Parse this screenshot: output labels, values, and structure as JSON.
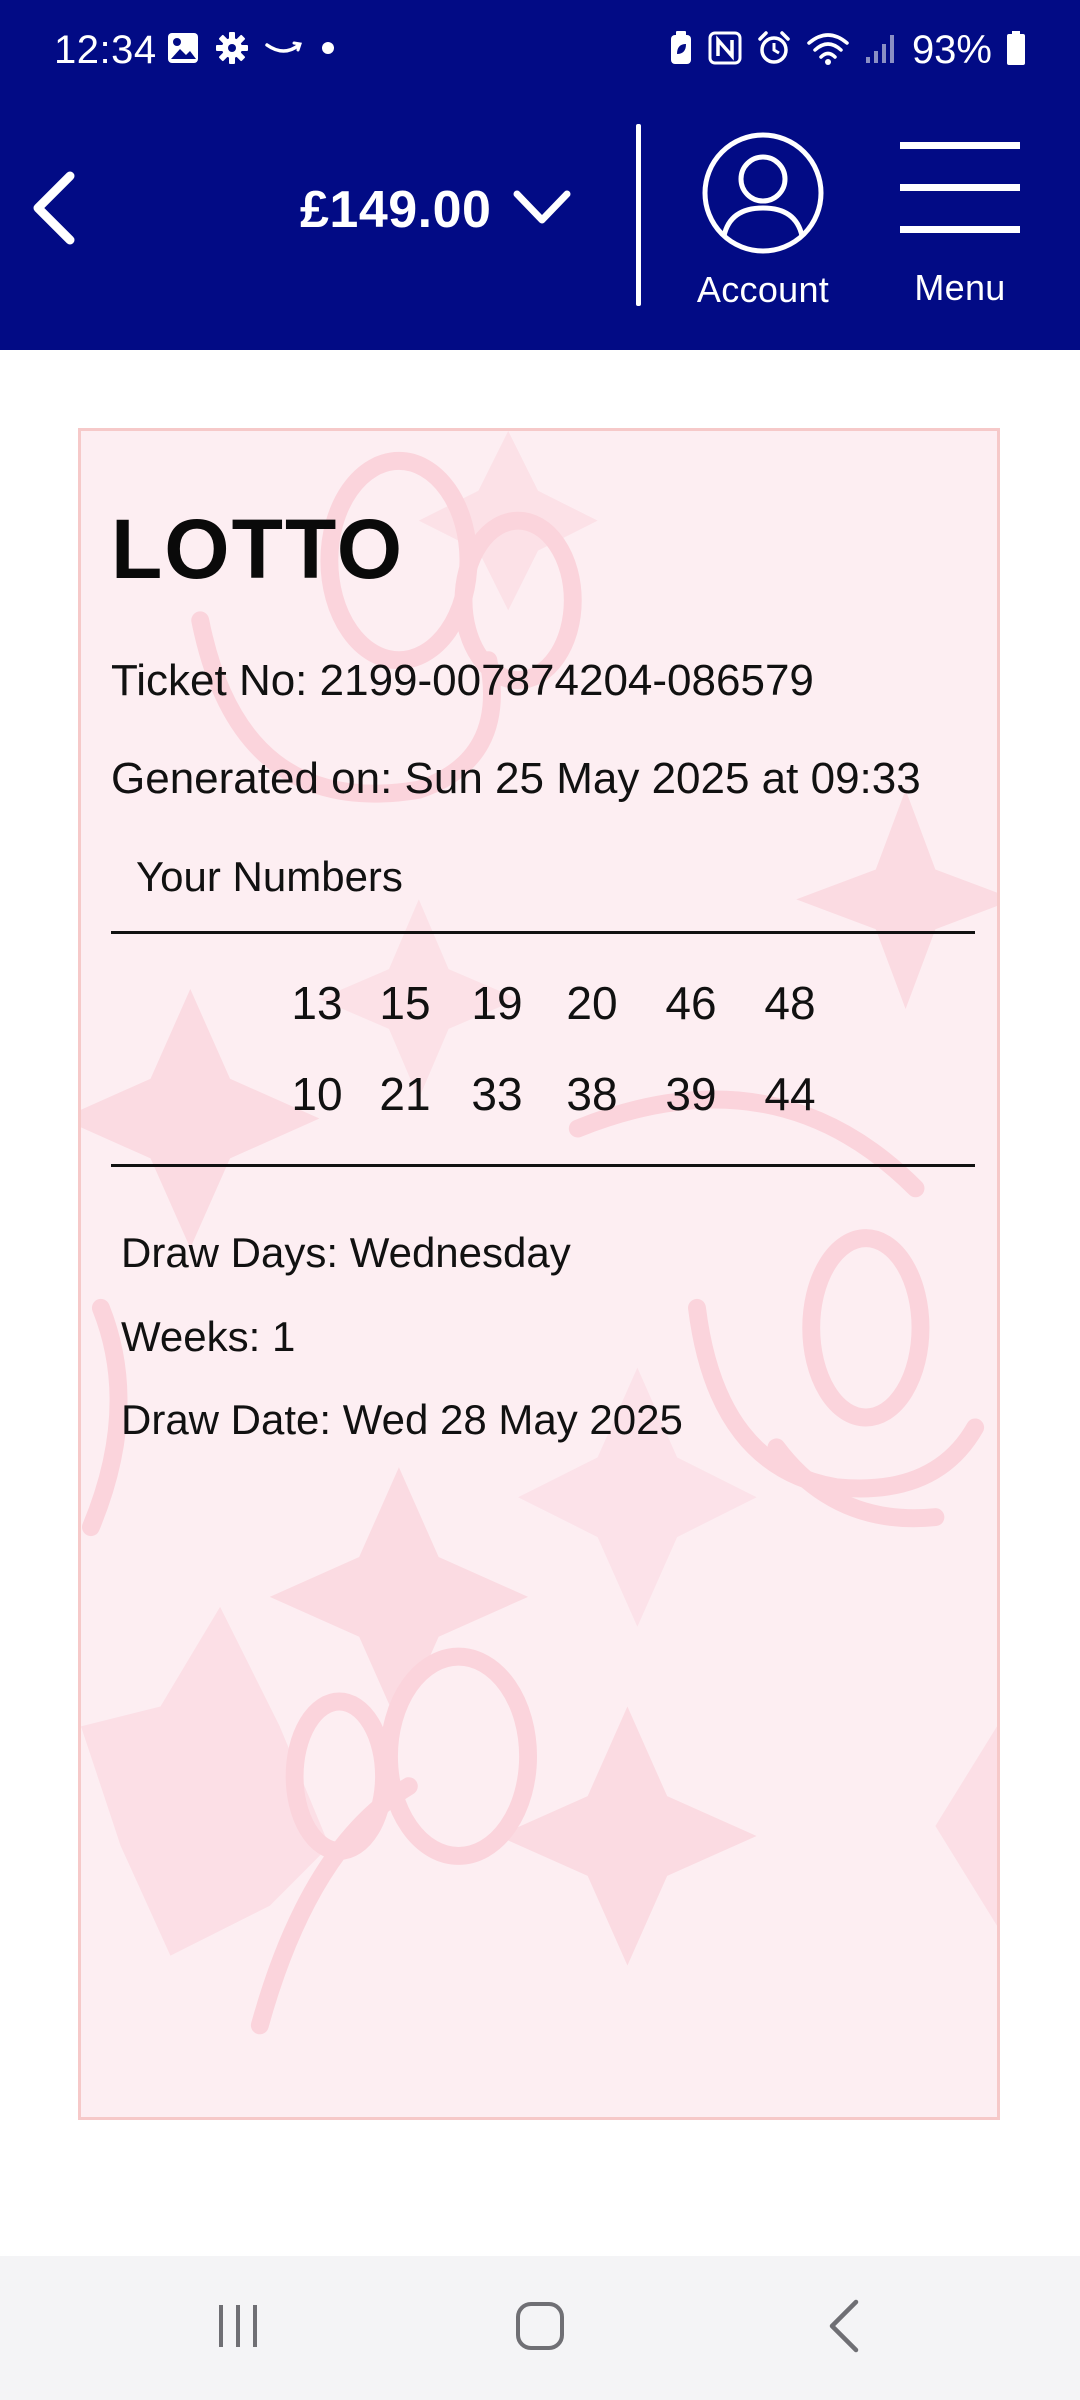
{
  "status_bar": {
    "time": "12:34",
    "battery": "93%",
    "left_icons": [
      "image-icon",
      "gear-icon",
      "amazon-smile-icon",
      "dot-icon"
    ],
    "right_icons": [
      "battery-saver-icon",
      "nfc-icon",
      "alarm-icon",
      "wifi-icon",
      "signal-icon",
      "battery-icon"
    ]
  },
  "header": {
    "balance": "£149.00",
    "account_label": "Account",
    "menu_label": "Menu",
    "background_color": "#020b85"
  },
  "ticket": {
    "game": "LOTTO",
    "ticket_no": "Ticket No: 2199-007874204-086579",
    "generated_on": "Generated on: Sun 25 May 2025 at 09:33",
    "your_numbers_label": "Your Numbers",
    "lines": [
      [
        "13",
        "15",
        "19",
        "20",
        "46",
        "48"
      ],
      [
        "10",
        "21",
        "33",
        "38",
        "39",
        "44"
      ]
    ],
    "draw_days": "Draw Days: Wednesday",
    "weeks": "Weeks: 1",
    "draw_date": "Draw Date: Wed 28 May 2025",
    "card_color": "#fdeef2"
  },
  "nav_bar": {
    "icons": [
      "recent-apps-icon",
      "home-icon",
      "back-icon"
    ]
  }
}
